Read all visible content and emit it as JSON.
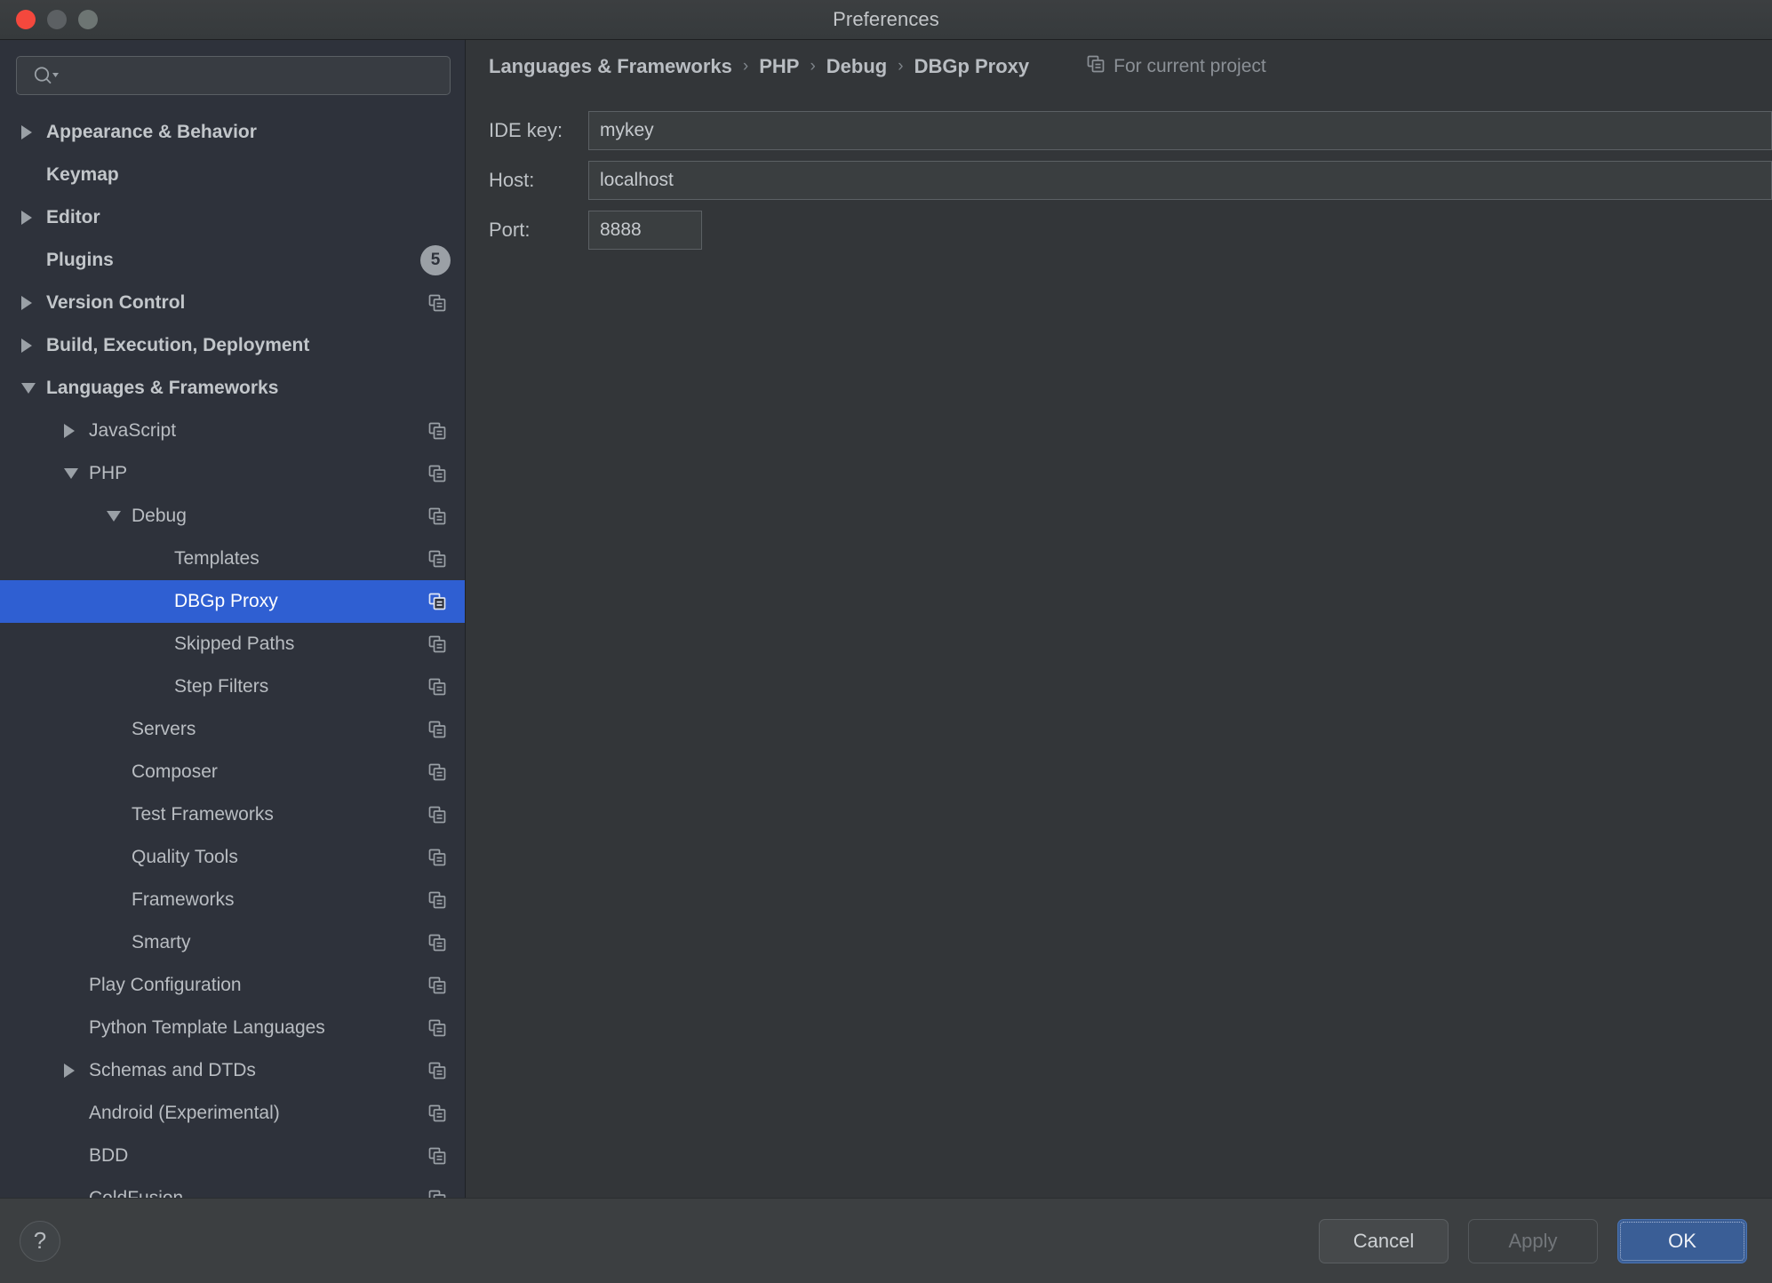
{
  "window": {
    "title": "Preferences",
    "traffic_lights": [
      "close",
      "minimize",
      "zoom"
    ]
  },
  "search": {
    "value": "",
    "placeholder": "",
    "icon": "search-icon"
  },
  "sidebar": {
    "items": [
      {
        "label": "Appearance & Behavior",
        "indent": 0,
        "bold": true,
        "arrow": "collapsed",
        "icon": false,
        "badge": null,
        "selected": false
      },
      {
        "label": "Keymap",
        "indent": 0,
        "bold": true,
        "arrow": "none",
        "icon": false,
        "badge": null,
        "selected": false
      },
      {
        "label": "Editor",
        "indent": 0,
        "bold": true,
        "arrow": "collapsed",
        "icon": false,
        "badge": null,
        "selected": false
      },
      {
        "label": "Plugins",
        "indent": 0,
        "bold": true,
        "arrow": "none",
        "icon": false,
        "badge": "5",
        "selected": false
      },
      {
        "label": "Version Control",
        "indent": 0,
        "bold": true,
        "arrow": "collapsed",
        "icon": true,
        "badge": null,
        "selected": false
      },
      {
        "label": "Build, Execution, Deployment",
        "indent": 0,
        "bold": true,
        "arrow": "collapsed",
        "icon": false,
        "badge": null,
        "selected": false
      },
      {
        "label": "Languages & Frameworks",
        "indent": 0,
        "bold": true,
        "arrow": "expanded",
        "icon": false,
        "badge": null,
        "selected": false
      },
      {
        "label": "JavaScript",
        "indent": 1,
        "bold": false,
        "arrow": "collapsed",
        "icon": true,
        "badge": null,
        "selected": false
      },
      {
        "label": "PHP",
        "indent": 1,
        "bold": false,
        "arrow": "expanded",
        "icon": true,
        "badge": null,
        "selected": false
      },
      {
        "label": "Debug",
        "indent": 2,
        "bold": false,
        "arrow": "expanded",
        "icon": true,
        "badge": null,
        "selected": false
      },
      {
        "label": "Templates",
        "indent": 3,
        "bold": false,
        "arrow": "none",
        "icon": true,
        "badge": null,
        "selected": false
      },
      {
        "label": "DBGp Proxy",
        "indent": 3,
        "bold": false,
        "arrow": "none",
        "icon": true,
        "badge": null,
        "selected": true
      },
      {
        "label": "Skipped Paths",
        "indent": 3,
        "bold": false,
        "arrow": "none",
        "icon": true,
        "badge": null,
        "selected": false
      },
      {
        "label": "Step Filters",
        "indent": 3,
        "bold": false,
        "arrow": "none",
        "icon": true,
        "badge": null,
        "selected": false
      },
      {
        "label": "Servers",
        "indent": 2,
        "bold": false,
        "arrow": "none",
        "icon": true,
        "badge": null,
        "selected": false
      },
      {
        "label": "Composer",
        "indent": 2,
        "bold": false,
        "arrow": "none",
        "icon": true,
        "badge": null,
        "selected": false
      },
      {
        "label": "Test Frameworks",
        "indent": 2,
        "bold": false,
        "arrow": "none",
        "icon": true,
        "badge": null,
        "selected": false
      },
      {
        "label": "Quality Tools",
        "indent": 2,
        "bold": false,
        "arrow": "none",
        "icon": true,
        "badge": null,
        "selected": false
      },
      {
        "label": "Frameworks",
        "indent": 2,
        "bold": false,
        "arrow": "none",
        "icon": true,
        "badge": null,
        "selected": false
      },
      {
        "label": "Smarty",
        "indent": 2,
        "bold": false,
        "arrow": "none",
        "icon": true,
        "badge": null,
        "selected": false
      },
      {
        "label": "Play Configuration",
        "indent": 1,
        "bold": false,
        "arrow": "none",
        "icon": true,
        "badge": null,
        "selected": false
      },
      {
        "label": "Python Template Languages",
        "indent": 1,
        "bold": false,
        "arrow": "none",
        "icon": true,
        "badge": null,
        "selected": false
      },
      {
        "label": "Schemas and DTDs",
        "indent": 1,
        "bold": false,
        "arrow": "collapsed",
        "icon": true,
        "badge": null,
        "selected": false
      },
      {
        "label": "Android (Experimental)",
        "indent": 1,
        "bold": false,
        "arrow": "none",
        "icon": true,
        "badge": null,
        "selected": false
      },
      {
        "label": "BDD",
        "indent": 1,
        "bold": false,
        "arrow": "none",
        "icon": true,
        "badge": null,
        "selected": false
      },
      {
        "label": "ColdFusion",
        "indent": 1,
        "bold": false,
        "arrow": "none",
        "icon": true,
        "badge": null,
        "selected": false
      }
    ]
  },
  "breadcrumb": {
    "crumbs": [
      "Languages & Frameworks",
      "PHP",
      "Debug",
      "DBGp Proxy"
    ],
    "separator": "›",
    "scope_label": "For current project",
    "scope_icon": "project-scope-icon"
  },
  "form": {
    "fields": [
      {
        "label": "IDE key:",
        "value": "mykey",
        "placeholder": "",
        "size": "wide"
      },
      {
        "label": "Host:",
        "value": "localhost",
        "placeholder": "",
        "size": "wide"
      },
      {
        "label": "Port:",
        "value": "8888",
        "placeholder": "",
        "size": "narrow"
      }
    ]
  },
  "bottom": {
    "help_label": "?",
    "cancel_label": "Cancel",
    "apply_label": "Apply",
    "ok_label": "OK"
  },
  "colors": {
    "selection_blue": "#2f5fd2",
    "primary_button": "#3a5e96",
    "sidebar_bg": "#2e323b",
    "content_bg": "#333639",
    "bottom_bg": "#3c3f41",
    "close_light": "#f4483d"
  }
}
